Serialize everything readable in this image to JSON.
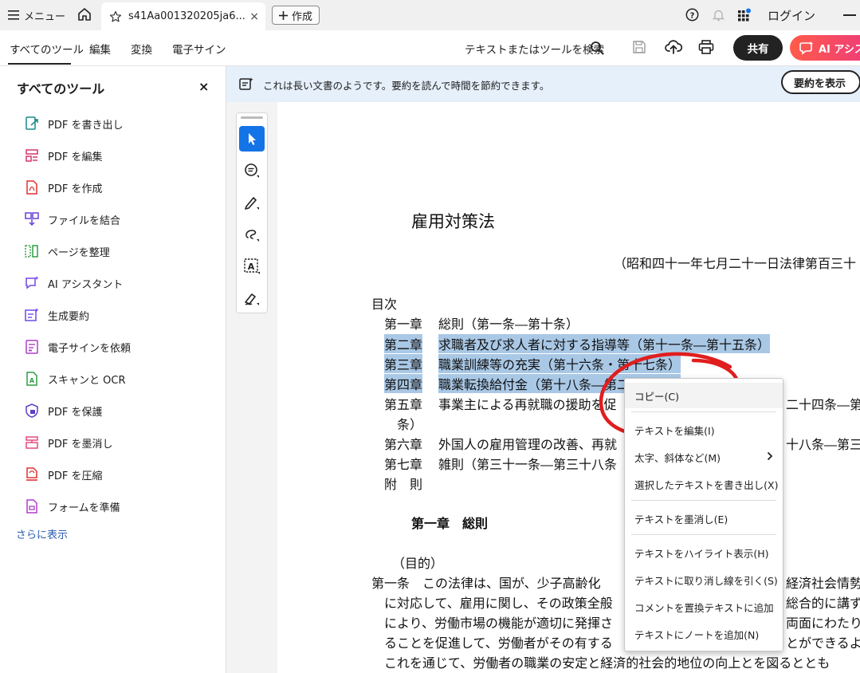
{
  "topbar": {
    "menu_label": "メニュー",
    "tab_title": "s41Aa001320205ja6...",
    "tab_close": "×",
    "new_label": "作成",
    "login_label": "ログイン"
  },
  "menubar": {
    "tabs": [
      "すべてのツール",
      "編集",
      "変換",
      "電子サイン"
    ],
    "search_label": "テキストまたはツールを検索",
    "share_label": "共有",
    "ai_label": "AI アシスタント"
  },
  "sidebar": {
    "title": "すべてのツール",
    "close": "×",
    "items": [
      {
        "label": "PDF を書き出し",
        "icon": "export-pdf-icon",
        "color": "#1a8a8a"
      },
      {
        "label": "PDF を編集",
        "icon": "edit-pdf-icon",
        "color": "#d6336c"
      },
      {
        "label": "PDF を作成",
        "icon": "create-pdf-icon",
        "color": "#e03131"
      },
      {
        "label": "ファイルを結合",
        "icon": "combine-files-icon",
        "color": "#6741d9"
      },
      {
        "label": "ページを整理",
        "icon": "organize-pages-icon",
        "color": "#2f9e44"
      },
      {
        "label": "AI アシスタント",
        "icon": "ai-assistant-icon",
        "color": "#7048e8"
      },
      {
        "label": "生成要約",
        "icon": "generative-summary-icon",
        "color": "#7048e8"
      },
      {
        "label": "電子サインを依頼",
        "icon": "request-esign-icon",
        "color": "#ae3ec9"
      },
      {
        "label": "スキャンと OCR",
        "icon": "scan-ocr-icon",
        "color": "#2f9e44"
      },
      {
        "label": "PDF を保護",
        "icon": "protect-pdf-icon",
        "color": "#5f3dc4"
      },
      {
        "label": "PDF を墨消し",
        "icon": "redact-pdf-icon",
        "color": "#e64980"
      },
      {
        "label": "PDF を圧縮",
        "icon": "compress-pdf-icon",
        "color": "#e03131"
      },
      {
        "label": "フォームを準備",
        "icon": "prepare-form-icon",
        "color": "#ae3ec9"
      }
    ],
    "show_more": "さらに表示"
  },
  "summary_bar": {
    "text": "これは長い文書のようです。要約を読んで時間を節約できます。",
    "button": "要約を表示"
  },
  "document": {
    "title": "雇用対策法",
    "promulgation": "（昭和四十一年七月二十一日法律第百三十",
    "toc_heading": "目次",
    "toc": [
      {
        "chapter": "第一章",
        "text": "総則（第一条―第十条）"
      },
      {
        "chapter": "第二章",
        "text": "求職者及び求人者に対する指導等（第十一条―第十五条）"
      },
      {
        "chapter": "第三章",
        "text": "職業訓練等の充実（第十六条・第十七条）"
      },
      {
        "chapter": "第四章",
        "text": "職業転換給付金（第十八条―第二十三条）"
      },
      {
        "chapter": "第五章",
        "text": "事業主による再就職の援助を促",
        "tail": "二十四条―第"
      },
      {
        "chapter": "",
        "text": "条）"
      },
      {
        "chapter": "第六章",
        "text": "外国人の雇用管理の改善、再就",
        "tail": "十八条―第三"
      },
      {
        "chapter": "第七章",
        "text": "雑則（第三十一条―第三十八条"
      },
      {
        "chapter": "附　則",
        "text": ""
      }
    ],
    "chapter1_heading": "第一章　総則",
    "purpose_heading": "（目的）",
    "body_lines": [
      {
        "lead": "第一条　この法律は、国が、少子高齢化",
        "tail": "経済社会情勢"
      },
      {
        "lead": "　に対応して、雇用に関し、その政策全般",
        "tail": "総合的に講ず"
      },
      {
        "lead": "　により、労働市場の機能が適切に発揮さ",
        "tail": "両面にわたり"
      },
      {
        "lead": "　ることを促進して、労働者がその有する",
        "tail": "とができるよ"
      },
      {
        "lead": "　これを通じて、労働者の職業の安定と経済的社会的地位の向上とを図るととも",
        "tail": ""
      }
    ]
  },
  "context_menu": {
    "items": [
      {
        "label": "コピー(C)"
      },
      {
        "label": "テキストを編集(I)"
      },
      {
        "label": "太字、斜体など(M)"
      },
      {
        "label": "選択したテキストを書き出し(X)"
      },
      {
        "label": "テキストを墨消し(E)"
      },
      {
        "label": "テキストをハイライト表示(H)"
      },
      {
        "label": "テキストに取り消し線を引く(S)"
      },
      {
        "label": "コメントを置換テキストに追加"
      },
      {
        "label": "テキストにノートを追加(N)"
      }
    ]
  },
  "colors": {
    "accent_blue": "#1473e6",
    "highlight": "#a9c8e6",
    "annotation_red": "#e01e1e",
    "summary_bg": "#e6f0fb"
  }
}
